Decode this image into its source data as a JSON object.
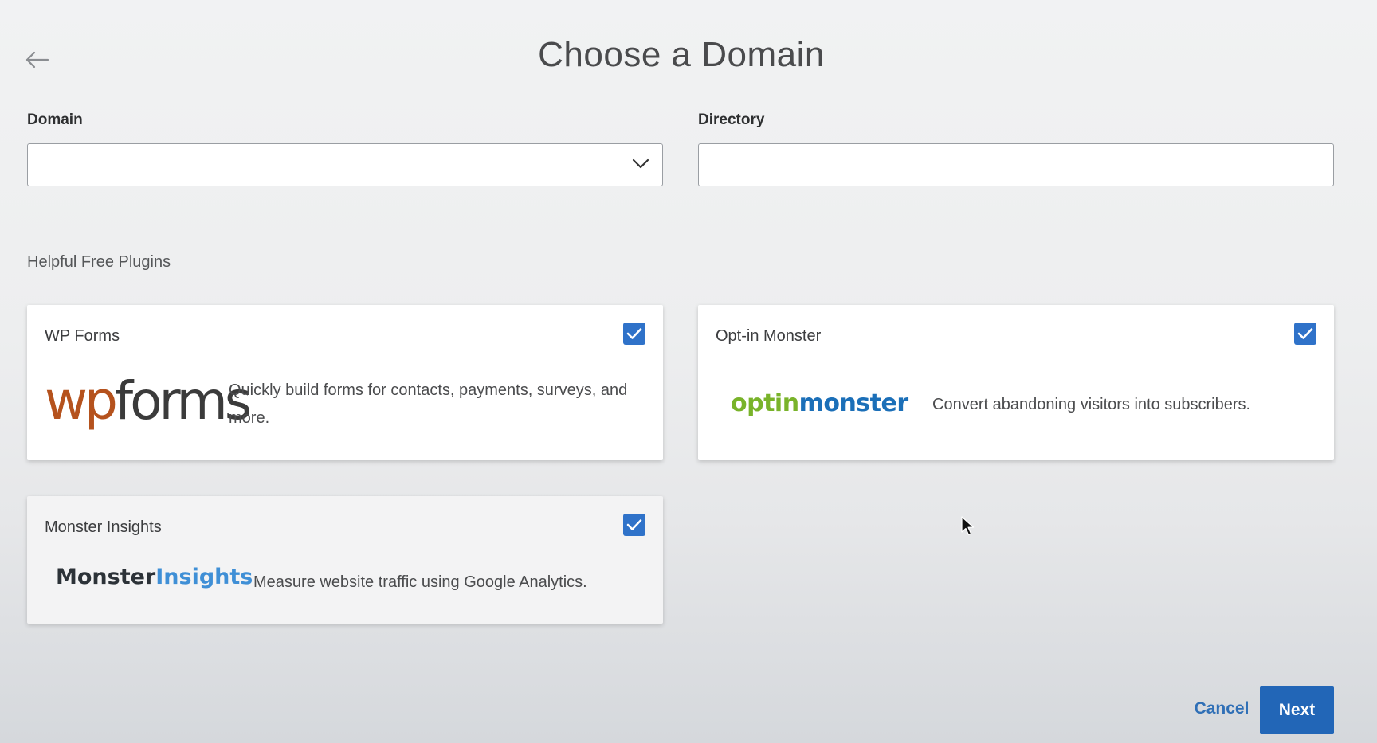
{
  "page": {
    "title": "Choose a Domain",
    "back_icon": "arrow-left-icon"
  },
  "form": {
    "domain": {
      "label": "Domain",
      "value": "",
      "icon": "chevron-down-icon"
    },
    "directory": {
      "label": "Directory",
      "value": "",
      "placeholder": ""
    }
  },
  "plugins": {
    "section_title": "Helpful Free Plugins",
    "checkbox_color": "#2f72c9",
    "items": [
      {
        "name": "WP Forms",
        "logo_parts": [
          "wp",
          "forms"
        ],
        "logo_colors": [
          "#b5521d",
          "#3b3b3b"
        ],
        "description": "Quickly build forms for contacts, payments, surveys, and more.",
        "checked": true
      },
      {
        "name": "Opt-in Monster",
        "logo_parts": [
          "optin",
          "monster"
        ],
        "logo_colors": [
          "#79b32a",
          "#1b6fb8"
        ],
        "description": "Convert abandoning visitors into subscribers.",
        "checked": true
      },
      {
        "name": "Monster Insights",
        "logo_parts": [
          "Monster",
          "Insights"
        ],
        "logo_colors": [
          "#2c3238",
          "#3f8fd6"
        ],
        "description": "Measure website traffic using Google Analytics.",
        "checked": true
      }
    ]
  },
  "footer": {
    "cancel_label": "Cancel",
    "next_label": "Next",
    "accent_color": "#2266b7"
  }
}
